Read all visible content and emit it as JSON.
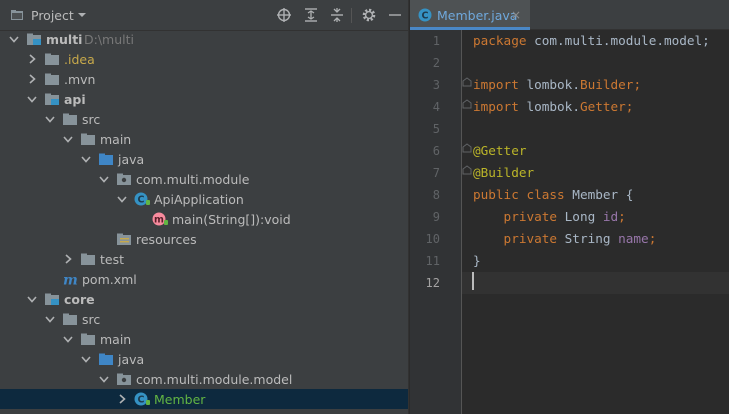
{
  "project_panel": {
    "title": "Project",
    "toolbar_icons": [
      "locate-icon",
      "expand-all-icon",
      "collapse-all-icon",
      "gear-icon",
      "minimize-icon"
    ],
    "tree": [
      {
        "label": "multi",
        "hint": "D:\\multi",
        "kind": "module-folder",
        "expanded": true,
        "bold": true
      },
      {
        "label": ".idea",
        "kind": "folder",
        "expanded": false,
        "style": "ignored"
      },
      {
        "label": ".mvn",
        "kind": "folder",
        "expanded": false
      },
      {
        "label": "api",
        "kind": "module-folder",
        "expanded": true,
        "bold": true
      },
      {
        "label": "src",
        "kind": "folder",
        "expanded": true
      },
      {
        "label": "main",
        "kind": "folder",
        "expanded": true
      },
      {
        "label": "java",
        "kind": "source-folder",
        "expanded": true
      },
      {
        "label": "com.multi.module",
        "kind": "package",
        "expanded": true
      },
      {
        "label": "ApiApplication",
        "kind": "class",
        "expanded": true
      },
      {
        "label": "main(String[]):void",
        "kind": "method"
      },
      {
        "label": "resources",
        "kind": "resources-folder"
      },
      {
        "label": "test",
        "kind": "folder",
        "expanded": false
      },
      {
        "label": "pom.xml",
        "kind": "maven-file"
      },
      {
        "label": "core",
        "kind": "module-folder",
        "expanded": true,
        "bold": true
      },
      {
        "label": "src",
        "kind": "folder",
        "expanded": true
      },
      {
        "label": "main",
        "kind": "folder",
        "expanded": true
      },
      {
        "label": "java",
        "kind": "source-folder",
        "expanded": true
      },
      {
        "label": "com.multi.module.model",
        "kind": "package",
        "expanded": true
      },
      {
        "label": "Member",
        "kind": "class",
        "expanded": false,
        "selected": true,
        "style": "green"
      }
    ]
  },
  "editor": {
    "tab": {
      "label": "Member.java",
      "close": "×"
    },
    "line_numbers": [
      "1",
      "2",
      "3",
      "4",
      "5",
      "6",
      "7",
      "8",
      "9",
      "10",
      "11",
      "12"
    ],
    "current_line": "12",
    "code_tokens": {
      "l1_kw": "package",
      "l1_rest": " com.multi.module.model;",
      "l3_kw": "import",
      "l3_pkg": " lombok.",
      "l3_name": "Builder",
      "l3_semi": ";",
      "l4_kw": "import",
      "l4_pkg": " lombok.",
      "l4_name": "Getter",
      "l4_semi": ";",
      "l6_ann": "@Getter",
      "l7_ann": "@Builder",
      "l8_kw": "public class",
      "l8_rest": " Member {",
      "l9_kw": "    private",
      "l9_type": " Long ",
      "l9_fld": "id",
      "l9_semi": ";",
      "l10_kw": "    private",
      "l10_type": " String ",
      "l10_fld": "name",
      "l10_semi": ";",
      "l11": "}"
    }
  },
  "colors": {
    "keyword": "#cc7832",
    "annotation": "#bbb529",
    "field": "#9876aa",
    "plain": "#a9b7c6",
    "panel_bg": "#3c3f41",
    "editor_bg": "#2b2b2b",
    "selection": "#0d293e"
  }
}
